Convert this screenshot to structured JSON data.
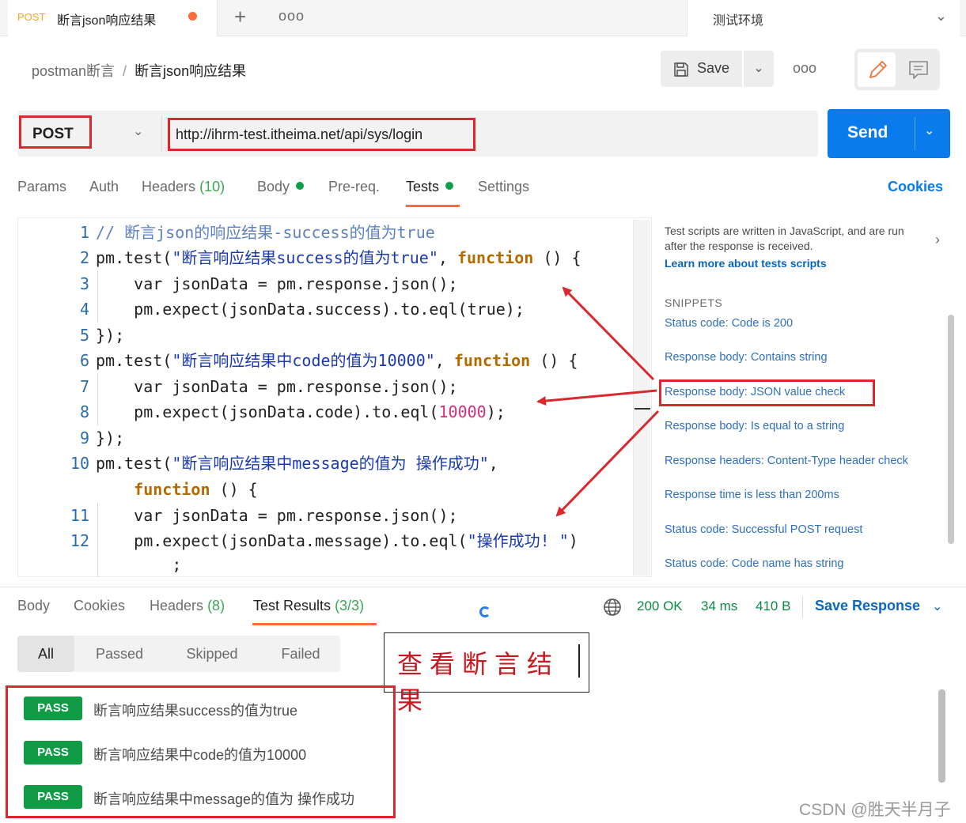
{
  "tab": {
    "method": "POST",
    "title": "断言json响应结果",
    "new_tab": "+",
    "more": "ooo"
  },
  "environment": {
    "label": "测试环境"
  },
  "breadcrumb": {
    "collection": "postman断言",
    "separator": "/",
    "current": "断言json响应结果"
  },
  "toolbar": {
    "save_label": "Save",
    "more": "ooo"
  },
  "request": {
    "method": "POST",
    "url": "http://ihrm-test.itheima.net/api/sys/login",
    "send_label": "Send"
  },
  "request_tabs": {
    "params": "Params",
    "auth": "Auth",
    "headers": "Headers",
    "headers_count": "(10)",
    "body": "Body",
    "prereq": "Pre-req.",
    "tests": "Tests",
    "settings": "Settings",
    "cookies": "Cookies"
  },
  "editor": {
    "line_numbers": [
      "1",
      "2",
      "3",
      "4",
      "5",
      "6",
      "7",
      "8",
      "9",
      "10",
      "11",
      "12"
    ]
  },
  "sidebar": {
    "description": "Test scripts are written in JavaScript, and are run after the response is received.",
    "learn_more": "Learn more about tests scripts",
    "snippets_title": "SNIPPETS",
    "snippets": [
      "Status code: Code is 200",
      "Response body: Contains string",
      "Response body: JSON value check",
      "Response body: Is equal to a string",
      "Response headers: Content-Type header check",
      "Response time is less than 200ms",
      "Status code: Successful POST request",
      "Status code: Code name has string"
    ]
  },
  "response": {
    "tabs": {
      "body": "Body",
      "cookies": "Cookies",
      "headers": "Headers",
      "headers_count": "(8)",
      "test_results": "Test Results",
      "test_results_count": "(3/3)"
    },
    "status": "200 OK",
    "time": "34 ms",
    "size": "410 B",
    "save_response": "Save Response",
    "filters": [
      "All",
      "Passed",
      "Skipped",
      "Failed"
    ],
    "results": [
      {
        "status": "PASS",
        "name": "断言响应结果success的值为true"
      },
      {
        "status": "PASS",
        "name": "断言响应结果中code的值为10000"
      },
      {
        "status": "PASS",
        "name": "断言响应结果中message的值为 操作成功"
      }
    ]
  },
  "annotation": {
    "note": "查看断言结果"
  },
  "watermark": "CSDN @胜天半月子",
  "colors": {
    "accent": "#ff6c37",
    "send": "#097bed",
    "pass": "#119b47",
    "highlight": "#d9282f"
  }
}
